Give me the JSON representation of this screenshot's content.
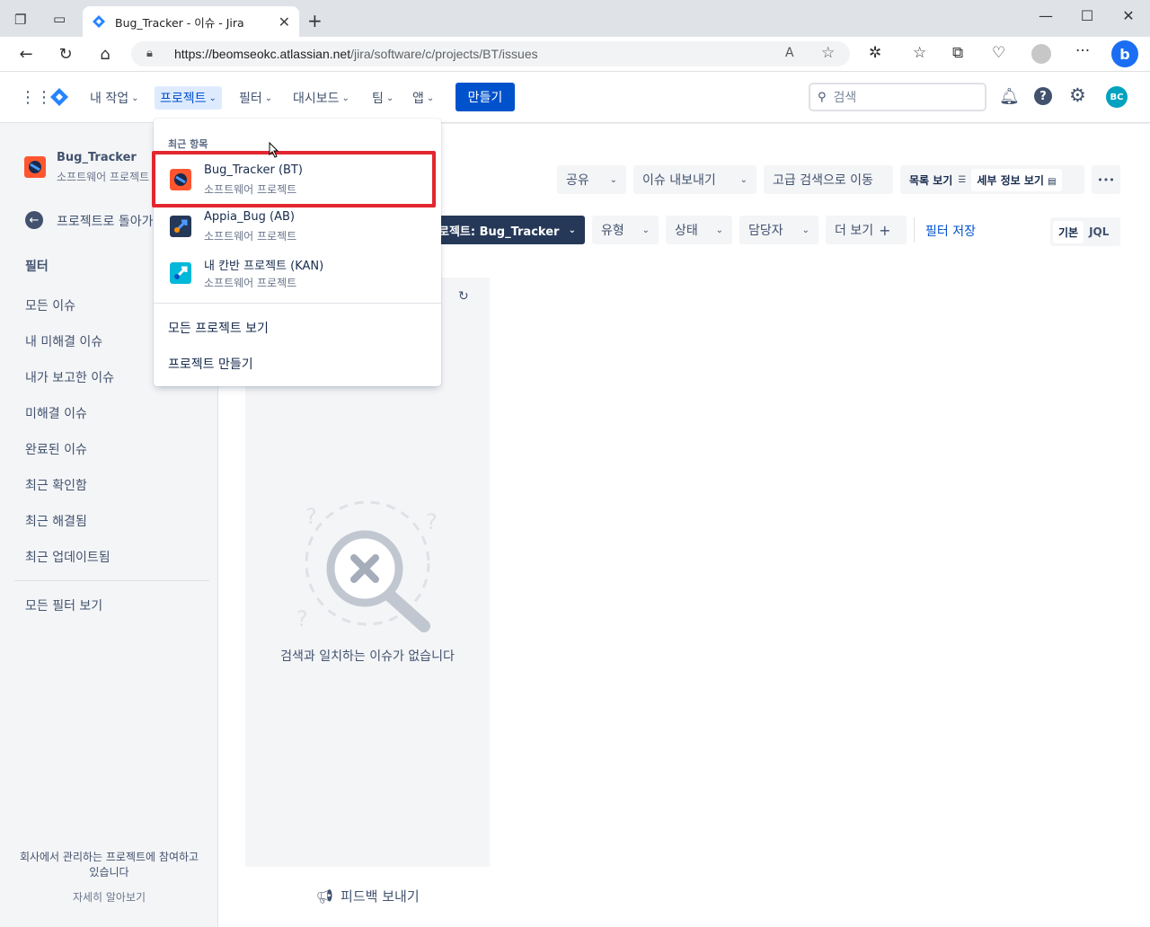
{
  "browser": {
    "tab_title": "Bug_Tracker - 이슈 - Jira",
    "url_host": "https://beomseokc.atlassian.net",
    "url_path": "/jira/software/c/projects/BT/issues"
  },
  "topnav": {
    "items": [
      "내 작업",
      "프로젝트",
      "필터",
      "대시보드",
      "팀",
      "앱"
    ],
    "create_label": "만들기",
    "search_placeholder": "검색",
    "avatar_initials": "BC"
  },
  "sidebar": {
    "project_name": "Bug_Tracker",
    "project_type": "소프트웨어 프로젝트",
    "back_label": "프로젝트로 돌아가기",
    "filters_heading": "필터",
    "filter_items": [
      "모든 이슈",
      "내 미해결 이슈",
      "내가 보고한 이슈",
      "미해결 이슈",
      "완료된 이슈",
      "최근 확인함",
      "최근 해결됨",
      "최근 업데이트됨"
    ],
    "all_filters": "모든 필터 보기",
    "footer_text_1": "회사에서 관리하는 프로젝트에 참여하고",
    "footer_text_2": "있습니다",
    "learn_more": "자세히 알아보기"
  },
  "toolbar": {
    "share": "공유",
    "export": "이슈 내보내기",
    "advanced": "고급 검색으로 이동",
    "list_view": "목록 보기",
    "detail_view": "세부 정보 보기",
    "more": "•••"
  },
  "filterbar": {
    "project": "로젝트: Bug_Tracker",
    "type": "유형",
    "status": "상태",
    "assignee": "담당자",
    "more": "더 보기",
    "save_filter": "필터 저장",
    "basic": "기본",
    "jql": "JQL"
  },
  "empty_state": {
    "message": "검색과 일치하는 이슈가 없습니다"
  },
  "feedback": "피드백 보내기",
  "dropdown": {
    "recent_heading": "최근 항목",
    "projects": [
      {
        "name": "Bug_Tracker (BT)",
        "type": "소프트웨어 프로젝트"
      },
      {
        "name": "Appia_Bug (AB)",
        "type": "소프트웨어 프로젝트"
      },
      {
        "name": "내 칸반 프로젝트 (KAN)",
        "type": "소프트웨어 프로젝트"
      }
    ],
    "view_all": "모든 프로젝트 보기",
    "create_project": "프로젝트 만들기"
  },
  "colors": {
    "primary": "#0052CC",
    "highlight_box": "#E3262E",
    "dark_button": "#253858"
  }
}
